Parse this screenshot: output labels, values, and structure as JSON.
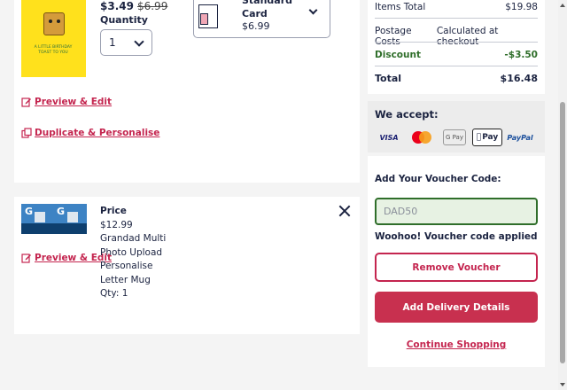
{
  "item1": {
    "price": "$3.49",
    "original_price": "$6.99",
    "quantity_label": "Quantity",
    "quantity_value": "1",
    "card_option_name": "Standard Card",
    "card_option_price": "$6.99",
    "thumbnail_text": "A little birthday toast to you",
    "preview_edit": "Preview & Edit",
    "duplicate": "Duplicate & Personalise"
  },
  "item2": {
    "price_label": "Price",
    "price": "$12.99",
    "name": "Grandad Multi Photo Upload Personalise Letter Mug",
    "qty": "Qty: 1",
    "thumbnail_letters": [
      "G",
      "G"
    ],
    "preview_edit": "Preview & Edit"
  },
  "summary": {
    "items_total_label": "Items Total",
    "items_total_value": "$19.98",
    "postage_label": "Postage Costs",
    "postage_value": "Calculated at checkout",
    "discount_label": "Discount",
    "discount_value": "-$3.50",
    "total_label": "Total",
    "total_value": "$16.48"
  },
  "payment": {
    "title": "We accept:",
    "methods": [
      "VISA",
      "Mastercard",
      "G Pay",
      "Apple Pay",
      "PayPal"
    ],
    "apple_pay_text": "Pay",
    "google_pay_text": "G Pay",
    "visa_text": "VISA",
    "paypal_text": "PayPal"
  },
  "voucher": {
    "label": "Add Your Voucher Code:",
    "code": "DAD50",
    "success_message": "Woohoo! Voucher code applied",
    "remove_button": "Remove Voucher",
    "delivery_button": "Add Delivery Details",
    "continue_link": "Continue Shopping"
  },
  "colors": {
    "accent": "#c4254f",
    "success": "#2f6e2a",
    "text": "#1b2340",
    "background": "#f4f4f4"
  }
}
